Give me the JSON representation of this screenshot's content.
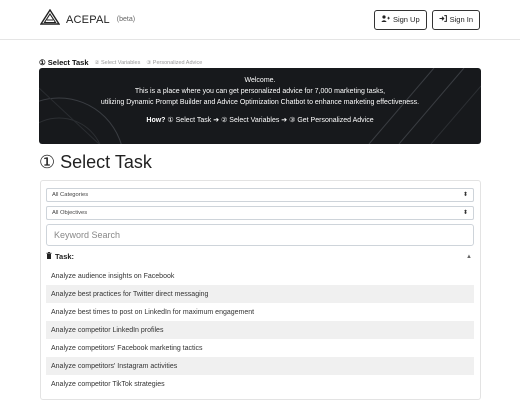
{
  "header": {
    "brand_name": "ACEPAL",
    "brand_beta": "(beta)",
    "sign_up_label": "Sign Up",
    "sign_in_label": "Sign In"
  },
  "steps": [
    {
      "label": "① Select Task",
      "active": true
    },
    {
      "label": "② Select Variables",
      "active": false
    },
    {
      "label": "③ Personalized Advice",
      "active": false
    }
  ],
  "banner": {
    "line1": "Welcome.",
    "line2": "This is a place where you can get personalized advice for 7,000 marketing tasks,",
    "line3": "utilizing Dynamic Prompt Builder and Advice Optimization Chatbot to enhance marketing effectiveness.",
    "how_label": "How?",
    "how_text": "① Select Task ➔ ② Select Variables ➔ ③ Get Personalized Advice"
  },
  "section_title": "① Select Task",
  "filters": {
    "category_value": "All Categories",
    "objective_value": "All Objectives",
    "search_placeholder": "Keyword Search"
  },
  "task_header": "Task:",
  "tasks": [
    "Analyze audience insights on Facebook",
    "Analyze best practices for Twitter direct messaging",
    "Analyze best times to post on LinkedIn for maximum engagement",
    "Analyze competitor LinkedIn profiles",
    "Analyze competitors' Facebook marketing tactics",
    "Analyze competitors' Instagram activities",
    "Analyze competitor TikTok strategies"
  ],
  "colors": {
    "banner_bg": "#17191c",
    "striped_row": "#f0f0f0"
  }
}
